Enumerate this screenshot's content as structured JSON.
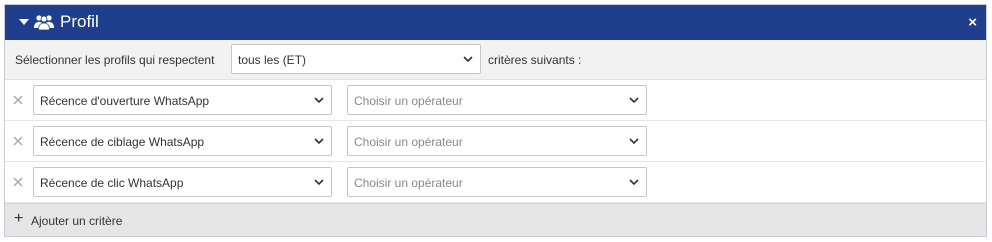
{
  "panel": {
    "title": "Profil",
    "close_label": "×",
    "header_color": "#1f3f8c"
  },
  "match": {
    "prefix": "Sélectionner les profils qui respectent",
    "selected": "tous les (ET)",
    "suffix": "critères suivants :"
  },
  "criteria": [
    {
      "field": "Récence d'ouverture WhatsApp",
      "operator_placeholder": "Choisir un opérateur"
    },
    {
      "field": "Récence de ciblage WhatsApp",
      "operator_placeholder": "Choisir un opérateur"
    },
    {
      "field": "Récence de clic WhatsApp",
      "operator_placeholder": "Choisir un opérateur"
    }
  ],
  "footer": {
    "add_label": "Ajouter un critère",
    "add_icon": "plus-icon"
  }
}
